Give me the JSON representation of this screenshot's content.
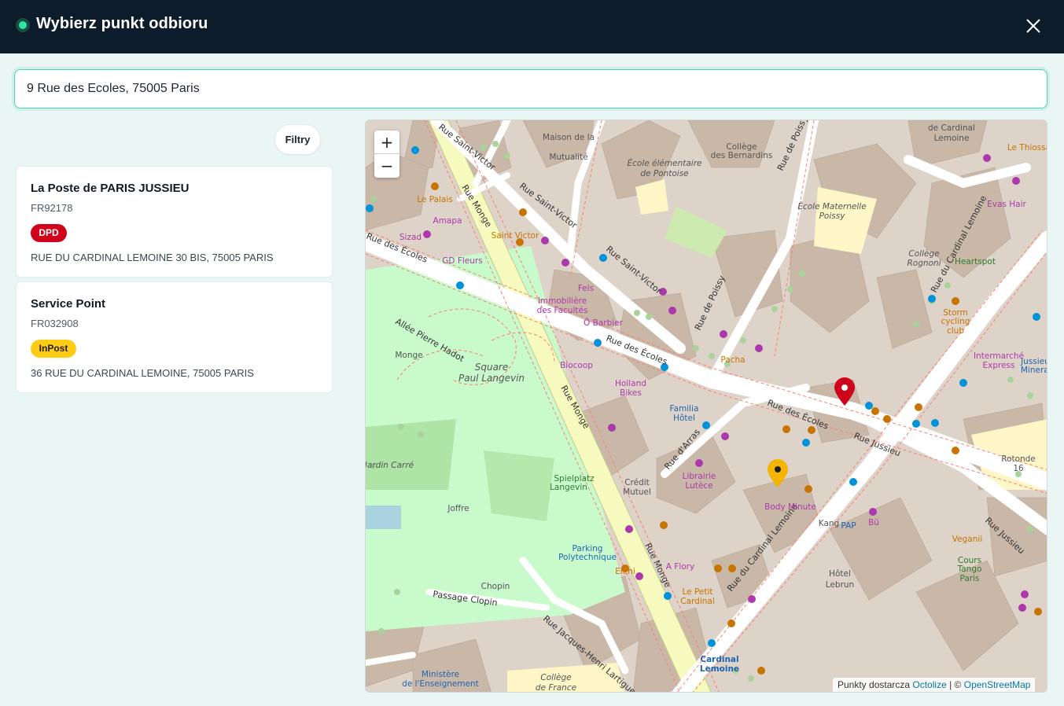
{
  "header": {
    "title": "Wybierz punkt odbioru",
    "close_icon": "close-icon"
  },
  "search": {
    "value": "9 Rue des Ecoles, 75005 Paris",
    "placeholder": ""
  },
  "filters": {
    "label": "Filtry"
  },
  "points": [
    {
      "name": "La Poste de PARIS JUSSIEU",
      "code": "FR92178",
      "carrier": "DPD",
      "carrier_color": "#d0021b",
      "address": "RUE DU CARDINAL LEMOINE 30 BIS, 75005 PARIS"
    },
    {
      "name": "Service Point",
      "code": "FR032908",
      "carrier": "InPost",
      "carrier_color": "#ffcc15",
      "address": "36 RUE DU CARDINAL LEMOINE, 75005 PARIS"
    }
  ],
  "map": {
    "zoom_in": "+",
    "zoom_out": "−",
    "attribution": {
      "prefix": "Punkty dostarcza",
      "octolize": "Octolize",
      "separator": "| ©",
      "osm": "OpenStreetMap"
    },
    "streets": [
      "Rue Monge",
      "Rue Saint-Victor",
      "Rue des Écoles",
      "Rue du Cardinal Lemoine",
      "Rue Jussieu",
      "Allée Pierre Hadot",
      "Rue de Poissy",
      "Rue d'Arras",
      "Passage Clopin",
      "Rue Jacques-Henri Lartigue"
    ],
    "places": [
      "Maison de la Mutualité",
      "Collège des Bernardins",
      "École élémentaire de Pontoise",
      "École Maternelle Poissy",
      "Collège Rognoni",
      "Square Paul Langevin",
      "Monge",
      "Joffre",
      "Chopin",
      "Hôtel Lebrun",
      "Rotonde 16",
      "Collège de France",
      "Ministère de l'Enseignement",
      "Jardin Carré",
      "Spielplatz Langevin",
      "Crédit Mutuel",
      "Librairie Lutèce",
      "Familia Hôtel",
      "Holland Bikes",
      "Biocoop",
      "Body Minute",
      "Kang",
      "PAP",
      "Bü",
      "Veganii",
      "Cours Tango Paris",
      "Intermarché Express",
      "Storm cycling club",
      "Heartspot",
      "Evas Hair",
      "Le Thiossane",
      "Le Palais",
      "Amapa",
      "Sizad",
      "GD Fleurs",
      "Saint Victor",
      "Immobilière des Facultés",
      "Ô Barbier",
      "Fels",
      "Pacha",
      "Eleni",
      "Le Petit Cardinal",
      "A Flory",
      "Parking Polytechnique",
      "Cardinal Lemoine",
      "de Cardinal Lemoine",
      "Jussieu Minerals"
    ],
    "markers": [
      {
        "type": "DPD",
        "color": "#d0021b"
      },
      {
        "type": "InPost",
        "color": "#f4b400"
      }
    ]
  }
}
